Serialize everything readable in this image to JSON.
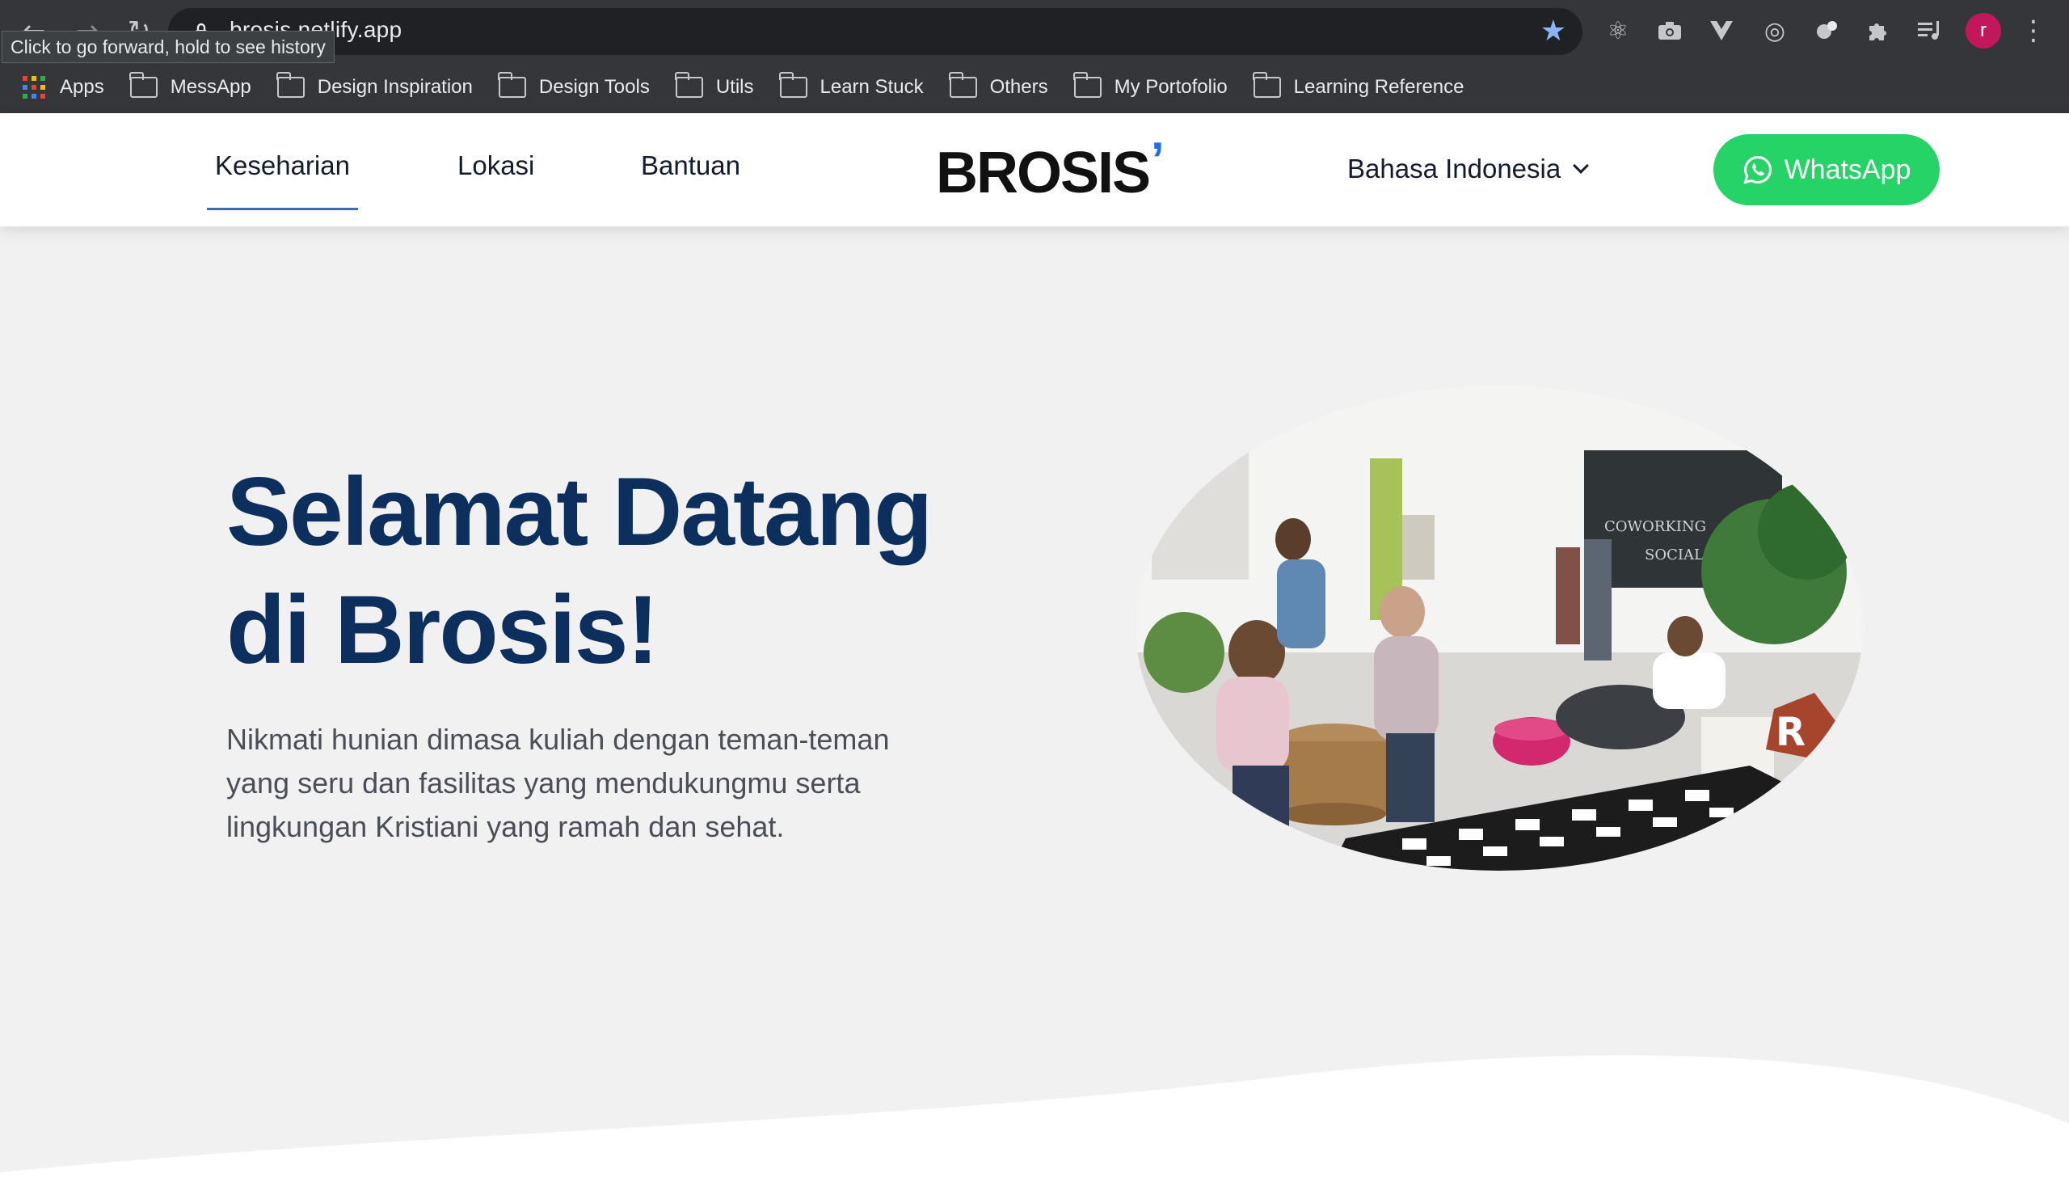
{
  "browser": {
    "url": "brosis.netlify.app",
    "tooltip": "Click to go forward, hold to see history",
    "avatar_initial": "r",
    "bookmarks": [
      {
        "label": "Apps",
        "icon": "apps-grid-icon"
      },
      {
        "label": "MessApp",
        "icon": "folder-icon"
      },
      {
        "label": "Design Inspiration",
        "icon": "folder-icon"
      },
      {
        "label": "Design Tools",
        "icon": "folder-icon"
      },
      {
        "label": "Utils",
        "icon": "folder-icon"
      },
      {
        "label": "Learn Stuck",
        "icon": "folder-icon"
      },
      {
        "label": "Others",
        "icon": "folder-icon"
      },
      {
        "label": "My Portofolio",
        "icon": "folder-icon"
      },
      {
        "label": "Learning Reference",
        "icon": "folder-icon"
      }
    ],
    "extensions": [
      "react-devtools-icon",
      "camera-icon",
      "vue-devtools-icon",
      "target-icon",
      "gemini-icon",
      "puzzle-extensions-icon",
      "media-control-icon"
    ]
  },
  "site": {
    "nav": [
      {
        "label": "Keseharian",
        "active": true
      },
      {
        "label": "Lokasi",
        "active": false
      },
      {
        "label": "Bantuan",
        "active": false
      }
    ],
    "logo": "BROSIS",
    "language": "Bahasa Indonesia",
    "whatsapp_label": "WhatsApp",
    "accent": "#25d366",
    "brand_color": "#0c2f5e"
  },
  "hero": {
    "title_line1": "Selamat Datang",
    "title_line2": "di Brosis!",
    "description": "Nikmati hunian dimasa kuliah dengan teman-teman yang seru dan fasilitas yang mendukungmu serta lingkungan Kristiani yang ramah dan sehat.",
    "image_alt": "coworking-lounge-photo"
  }
}
